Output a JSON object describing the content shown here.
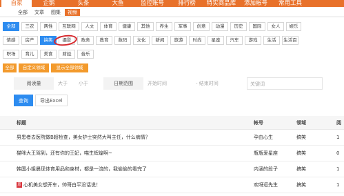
{
  "topnav": {
    "items": [
      "自家",
      "企鹅",
      "头条",
      "大鱼",
      "监控账号",
      "排行榜",
      "特实商品库",
      "添加帐号",
      "常用工具"
    ],
    "active_index": 0
  },
  "subtabs": {
    "items": [
      "全部",
      "文章",
      "图集",
      "视频"
    ],
    "active_index": 3
  },
  "categories": {
    "row1": [
      "全部",
      "三农",
      "两性",
      "互联网",
      "人文",
      "体育",
      "健康",
      "其他",
      "养生",
      "军事",
      "创意",
      "动漫",
      "历史",
      "国际",
      "女人",
      "娱乐"
    ],
    "row2": [
      "情感",
      "房产",
      "搞笑",
      "摄影",
      "政务",
      "教育",
      "数码",
      "文化",
      "新闻",
      "旅游",
      "时尚",
      "星座",
      "汽车",
      "游戏",
      "生活",
      "生活百"
    ],
    "row3": [
      "职场",
      "育儿",
      "美食",
      "财经",
      "音乐"
    ],
    "row4": [
      "全部",
      "自定义领域",
      "显示全部领域"
    ],
    "active_row1": 0,
    "active_row2": 2,
    "active_row4": 0
  },
  "filter": {
    "read_label": "阅读量",
    "min_placeholder": "大于",
    "max_placeholder": "小于",
    "date_label": "日期范围",
    "start_placeholder": "开始时间",
    "end_placeholder": "- 结束时间",
    "keyword_placeholder": "关键词"
  },
  "buttons": {
    "query": "查询",
    "export": "导出Excel"
  },
  "table": {
    "headers": [
      "标题",
      "帐号",
      "领域",
      "阅"
    ],
    "rows": [
      {
        "title": "男患者去医院做B超检查，美女护士突然大叫主任，什么病情？",
        "account": "孕由心生",
        "field": "搞笑",
        "read": "1",
        "tag": ""
      },
      {
        "title": "猫咪大王驾到，还有你的王妃，喵生辉煌啊~",
        "account": "瓶瓶爱星座",
        "field": "搞笑",
        "read": "0",
        "tag": ""
      },
      {
        "title": "韩国小姐晨现体育用品和身材，都是一流的，我偷偷的看完了",
        "account": "内涵的段子",
        "field": "搞笑",
        "read": "1",
        "tag": ""
      },
      {
        "title": "心机美女想开车，帅哥白平没话说！",
        "account": "欢呀逗先生",
        "field": "搞笑",
        "read": "1",
        "tag": "原"
      }
    ]
  }
}
